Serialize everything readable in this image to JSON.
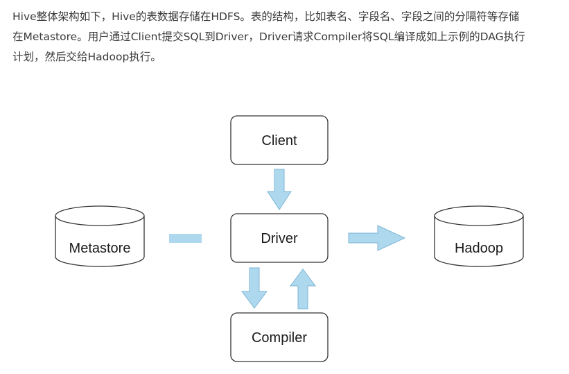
{
  "article": {
    "lines": [
      "Hive整体架构如下，Hive的表数据存储在HDFS。表的结构，比如表名、字段名、字段之间的分隔符等存储",
      "在Metastore。用户通过Client提交SQL到Driver，Driver请求Compiler将SQL编译成如上示例的DAG执行",
      "计划，然后交给Hadoop执行。"
    ]
  },
  "diagram": {
    "nodes": {
      "client": "Client",
      "driver": "Driver",
      "compiler": "Compiler",
      "metastore": "Metastore",
      "hadoop": "Hadoop"
    },
    "colors": {
      "arrow_fill": "#add8ee",
      "arrow_stroke": "#7eb6d6",
      "box_stroke": "#333333",
      "box_fill": "#ffffff"
    }
  }
}
